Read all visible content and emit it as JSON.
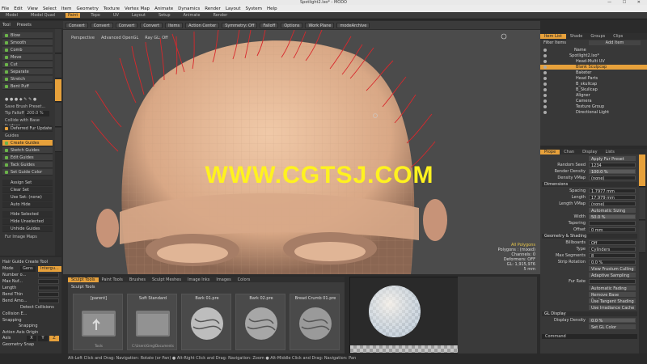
{
  "window": {
    "title": "Spotlight2.lxo* - MODO"
  },
  "menubar": [
    "File",
    "Edit",
    "View",
    "Select",
    "Item",
    "Geometry",
    "Texture",
    "Vertex Map",
    "Animate",
    "Dynamics",
    "Render",
    "Layout",
    "System",
    "Help"
  ],
  "tabs": [
    {
      "label": "Model",
      "active": false
    },
    {
      "label": "Model Quad",
      "active": false
    },
    {
      "label": "Paint",
      "active": true
    },
    {
      "label": "Topo",
      "active": false
    },
    {
      "label": "UV",
      "active": false
    },
    {
      "label": "Layout",
      "active": false
    },
    {
      "label": "Setup",
      "active": false
    },
    {
      "label": "Animate",
      "active": false
    },
    {
      "label": "Render",
      "active": false
    }
  ],
  "left_top": {
    "tool": "Tool",
    "presets": "Presets"
  },
  "sculpt_tools": [
    "Blow",
    "Smooth",
    "Comb",
    "Move",
    "Cut",
    "Separate",
    "Stretch",
    "Bent Puff"
  ],
  "brush_preset": {
    "save": "Save Brush Preset...",
    "tip_falloff_label": "Tip Falloff",
    "tip_falloff_value": "200.0 %",
    "collide": "Collide with Base Surface",
    "deferred": "Deferred Fur Update"
  },
  "guides": {
    "header": "Guides",
    "items": [
      "Create Guides",
      "Sketch Guides",
      "Edit Guides",
      "Tack Guides",
      "Set Guide Color"
    ]
  },
  "sets": {
    "assign": "Assign Set",
    "clear": "Clear Set",
    "use_set_label": "Use Set: (none)",
    "auto_hide": "Auto Hide",
    "hide_selected": "Hide Selected Guides",
    "hide_unselected": "Hide Unselected Guides",
    "unhide": "Unhide Guides"
  },
  "fur_image_maps": "Fur Image Maps",
  "lower_left": {
    "header": "Hair Guide Create Tool",
    "mode_label": "Mode",
    "mode_a": "Gens",
    "mode_b": "Intergu...",
    "rows": [
      "Number o...",
      "Max Nuf...",
      "Length",
      "Bend Thin",
      "Bend Amo..."
    ],
    "detect": "Detect Collisions",
    "collision": "Collision E...",
    "snapping_hdr": "Snapping",
    "snapping_val": "Snapping",
    "action_axis": "Action Axis Origin",
    "axis_label": "Axis",
    "axis_vals": [
      "X",
      "Y",
      "Z"
    ],
    "geometry_snap": "Geometry Snap"
  },
  "viewport": {
    "toolbar": [
      "Convert",
      "Convert",
      "Convert",
      "Convert",
      "Items",
      "Action Center",
      "Symmetry: Off",
      "Falloff",
      "Options",
      "Work Plane",
      "modeArchive"
    ],
    "labels": {
      "view": "Perspective",
      "mode": "Advanced OpenGL",
      "ray": "Ray GL: Off"
    },
    "info": {
      "selection": "All Polygons",
      "polys": "Polygons : (mixed)",
      "channels": "Channels: 0",
      "deformers": "Deformers: OFF",
      "gl": "GL: 1,915,976",
      "time": "5 mm"
    },
    "watermark": "WWW.CGTSJ.COM"
  },
  "right_tabs": [
    {
      "label": "Item List",
      "on": true
    },
    {
      "label": "Shade",
      "on": false
    },
    {
      "label": "Groups",
      "on": false
    },
    {
      "label": "Clips",
      "on": false
    }
  ],
  "item_list": {
    "filter": "Filter Items",
    "add": "Add Item",
    "items": [
      {
        "label": "Name",
        "sel": false
      },
      {
        "label": "Spotlight2.lxo*",
        "sel": false
      },
      {
        "label": "Head-Multi UV",
        "sel": false
      },
      {
        "label": "Blank Sculpcap",
        "sel": true
      },
      {
        "label": "Baketer",
        "sel": false
      },
      {
        "label": "Head Parts",
        "sel": false
      },
      {
        "label": "B_skullcap",
        "sel": false
      },
      {
        "label": "B_Skullcap",
        "sel": false
      },
      {
        "label": "Aligner",
        "sel": false
      },
      {
        "label": "Camera",
        "sel": false
      },
      {
        "label": "Texture Group",
        "sel": false
      },
      {
        "label": "Directional Light",
        "sel": false
      }
    ]
  },
  "props_tabs": [
    {
      "label": "Prope",
      "on": true
    },
    {
      "label": "Chan",
      "on": false
    },
    {
      "label": "Display",
      "on": false
    },
    {
      "label": "Lists",
      "on": false
    }
  ],
  "properties": {
    "apply": "Apply Fur Preset",
    "random_seed": {
      "label": "Random Seed",
      "value": "1234"
    },
    "render_density": {
      "label": "Render Density",
      "value": "100.0 %"
    },
    "density_vmap": {
      "label": "Density VMap",
      "value": "(none)"
    },
    "dimensions_hdr": "Dimensions",
    "spacing": {
      "label": "Spacing",
      "value": "1.7977 mm"
    },
    "length": {
      "label": "Length",
      "value": "17.979 mm"
    },
    "length_vmap": {
      "label": "Length VMap",
      "value": "(none)"
    },
    "auto_sizing": "Automatic Sizing",
    "width": {
      "label": "Width",
      "value": "50.0 %"
    },
    "tapering": {
      "label": "Tapering",
      "value": ""
    },
    "offset": {
      "label": "Offset",
      "value": "0 mm"
    },
    "geo_hdr": "Geometry & Shading",
    "billboards": {
      "label": "Billboards",
      "value": "Off"
    },
    "type": {
      "label": "Type",
      "value": "Cylinders"
    },
    "max_segments": {
      "label": "Max Segments",
      "value": "8"
    },
    "strip_rotation": {
      "label": "Strip Rotation",
      "value": "0.0 %"
    },
    "view_frustum": "View Frustum Culling",
    "adaptive": "Adaptive Sampling",
    "fur_rate": {
      "label": "Fur Rate",
      "value": ""
    },
    "auto_fading": "Automatic Fading",
    "remove_base": "Remove Base Surface",
    "tangent": "Use Tangent Shading",
    "irradiance": "Use Irradiance Cache",
    "gl_hdr": "GL Display",
    "display_density": {
      "label": "Display Density",
      "value": "0.0 %"
    },
    "set_gl_color": "Set GL Color",
    "command": "Command"
  },
  "bottom_tabs": [
    {
      "label": "Sculpt Tools",
      "on": true
    },
    {
      "label": "Paint Tools",
      "on": false
    },
    {
      "label": "Brushes",
      "on": false
    },
    {
      "label": "Sculpt Meshes",
      "on": false
    },
    {
      "label": "Image Inks",
      "on": false
    },
    {
      "label": "Images",
      "on": false
    },
    {
      "label": "Colors",
      "on": false
    }
  ],
  "preset_path": "Sculpt Tools",
  "presets": [
    {
      "name": "[parent]",
      "sub": "Tools"
    },
    {
      "name": "Soft Standard",
      "sub": "C:\\Users\\Greg\\Documents"
    },
    {
      "name": "Bark 01.pre",
      "sub": ""
    },
    {
      "name": "Bark 02.pre",
      "sub": ""
    },
    {
      "name": "Bread Crumb 01.pre",
      "sub": ""
    }
  ],
  "status": "Alt-Left Click and Drag: Navigation: Rotate (or Pan)  ●  Alt-Right Click and Drag: Navigation: Zoom  ●  Alt-Middle Click and Drag: Navigation: Pan"
}
